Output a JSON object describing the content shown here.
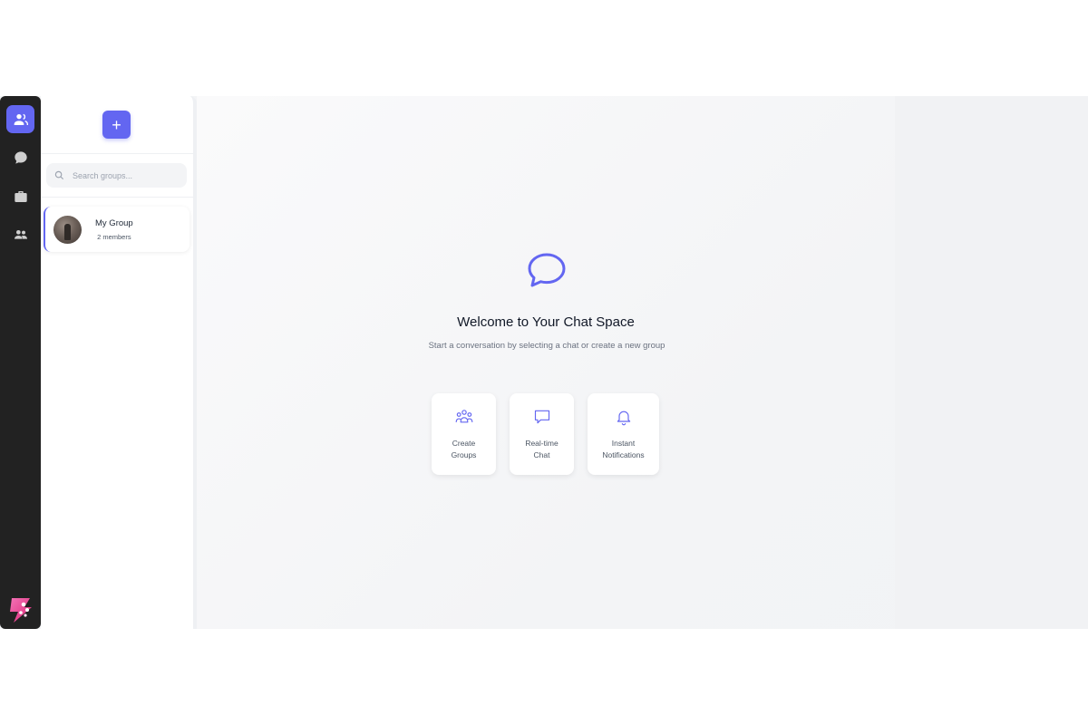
{
  "colors": {
    "accent": "#6366f1",
    "rail_bg": "#222222",
    "panel_bg": "#ffffff",
    "main_bg": "#f3f4f6"
  },
  "rail": {
    "items": [
      {
        "icon": "users-icon",
        "active": true
      },
      {
        "icon": "chat-bubble-icon",
        "active": false
      },
      {
        "icon": "briefcase-icon",
        "active": false
      },
      {
        "icon": "people-icon",
        "active": false
      }
    ],
    "logo_icon": "app-logo-icon"
  },
  "panel": {
    "add_button_label": "+",
    "search": {
      "placeholder": "Search groups...",
      "value": ""
    },
    "groups": [
      {
        "name": "My Group",
        "members": "2 members"
      }
    ]
  },
  "main": {
    "icon": "chat-bubble-icon",
    "title": "Welcome to Your Chat Space",
    "subtitle": "Start a conversation by selecting a chat or create a new group",
    "features": [
      {
        "icon": "group-icon",
        "label": "Create\nGroups"
      },
      {
        "icon": "message-icon",
        "label": "Real-time\nChat"
      },
      {
        "icon": "bell-icon",
        "label": "Instant\nNotifications"
      }
    ]
  }
}
